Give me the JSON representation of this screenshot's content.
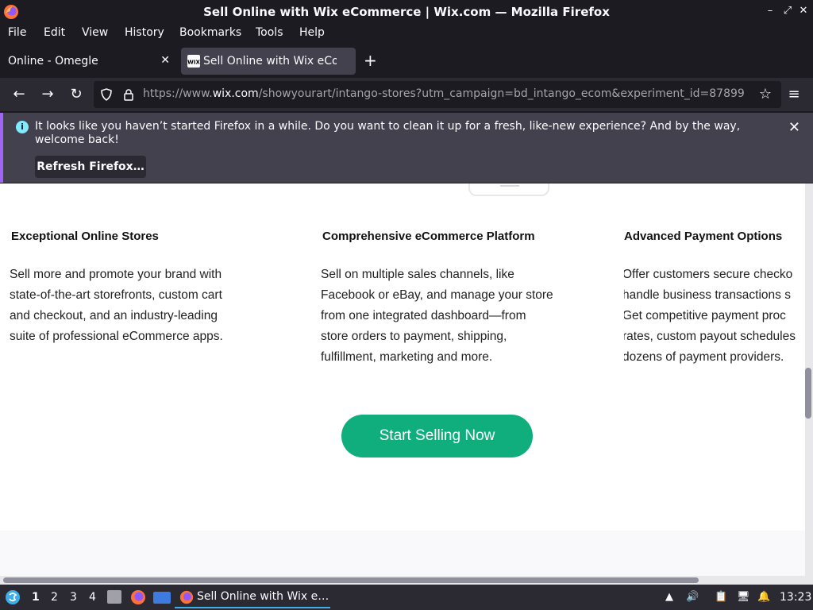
{
  "window": {
    "title": "Sell Online with Wix eCommerce | Wix.com — Mozilla Firefox"
  },
  "menu": [
    "File",
    "Edit",
    "View",
    "History",
    "Bookmarks",
    "Tools",
    "Help"
  ],
  "tabs": [
    {
      "label": "Online - Omegle",
      "active": false
    },
    {
      "label": "Sell Online with Wix eCom",
      "active": true
    }
  ],
  "url": {
    "prefix": "https://www.",
    "domain": "wix.com",
    "rest": "/showyourart/intango-stores?utm_campaign=bd_intango_ecom&experiment_id=87899"
  },
  "notice": {
    "message": "It looks like you haven’t started Firefox in a while. Do you want to clean it up for a fresh, like-new experience? And by the way, welcome back!",
    "button": "Refresh Firefox…"
  },
  "features": [
    {
      "title": "Exceptional Online Stores",
      "text": "Sell more and promote your brand with\nstate-of-the-art storefronts, custom cart\nand checkout, and an industry-leading\nsuite of professional eCommerce apps."
    },
    {
      "title": "Comprehensive eCommerce Platform",
      "text": "Sell on multiple sales channels, like\nFacebook or eBay, and manage your store\nfrom one integrated dashboard—from\nstore orders to payment, shipping,\nfulfillment, marketing and more."
    },
    {
      "title": "Advanced Payment Options",
      "text": "Offer customers secure checko\nhandle business transactions s\nGet competitive payment proc\nrates, custom payout schedules\ndozens of payment providers."
    }
  ],
  "cta": {
    "label": "Start Selling Now",
    "color": "#0fae7c"
  },
  "taskbar": {
    "workspaces": [
      "1",
      "2",
      "3",
      "4"
    ],
    "task_label": "Sell Online with Wix e…",
    "clock": "13:23"
  }
}
